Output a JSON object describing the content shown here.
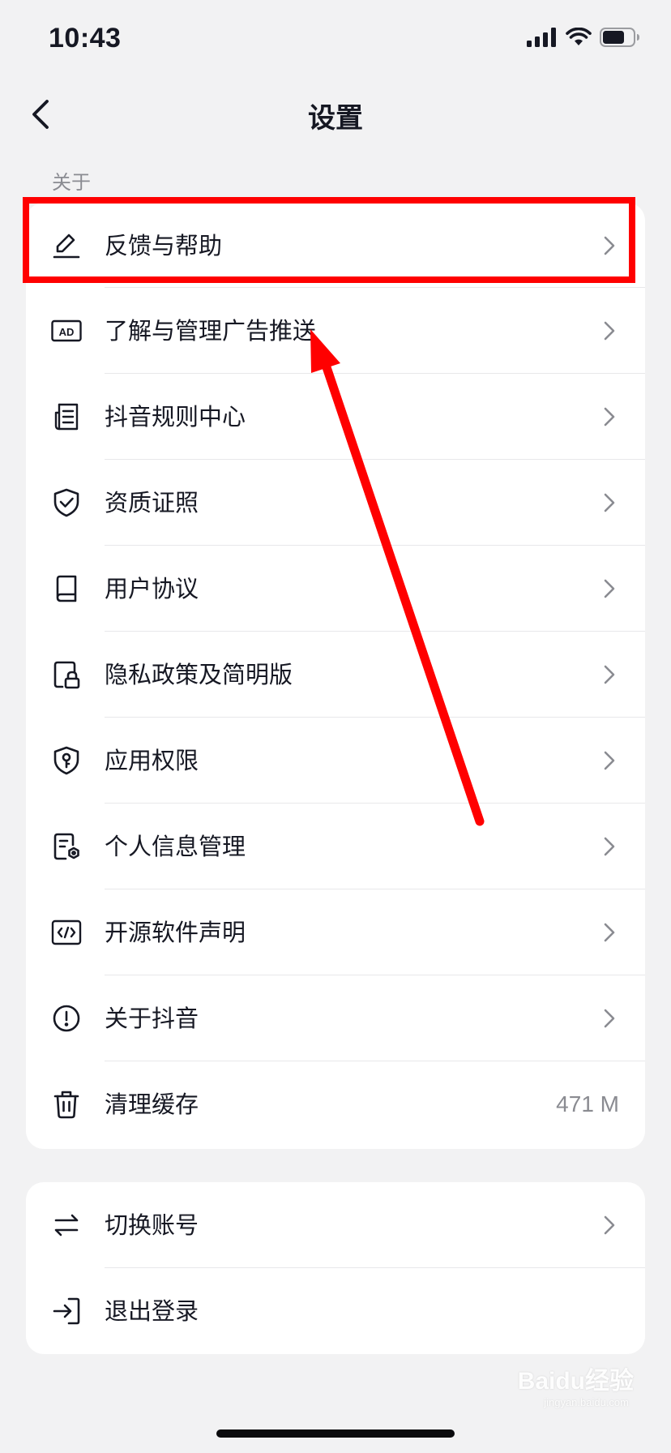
{
  "status_bar": {
    "time": "10:43",
    "icons": [
      "signal-icon",
      "wifi-icon",
      "battery-icon"
    ]
  },
  "nav": {
    "title": "设置",
    "back_icon": "chevron-left-icon"
  },
  "section_about": {
    "label": "关于",
    "items": [
      {
        "label": "反馈与帮助",
        "icon": "pencil-icon",
        "trailing": "chevron"
      },
      {
        "label": "了解与管理广告推送",
        "icon": "ad-icon",
        "trailing": "chevron"
      },
      {
        "label": "抖音规则中心",
        "icon": "document-list-icon",
        "trailing": "chevron"
      },
      {
        "label": "资质证照",
        "icon": "shield-check-icon",
        "trailing": "chevron"
      },
      {
        "label": "用户协议",
        "icon": "book-icon",
        "trailing": "chevron"
      },
      {
        "label": "隐私政策及简明版",
        "icon": "privacy-lock-icon",
        "trailing": "chevron"
      },
      {
        "label": "应用权限",
        "icon": "shield-key-icon",
        "trailing": "chevron"
      },
      {
        "label": "个人信息管理",
        "icon": "personal-info-icon",
        "trailing": "chevron"
      },
      {
        "label": "开源软件声明",
        "icon": "code-icon",
        "trailing": "chevron"
      },
      {
        "label": "关于抖音",
        "icon": "info-circle-icon",
        "trailing": "chevron"
      },
      {
        "label": "清理缓存",
        "icon": "trash-icon",
        "trailing": "value",
        "value": "471 M"
      }
    ]
  },
  "section_account": {
    "items": [
      {
        "label": "切换账号",
        "icon": "switch-arrows-icon",
        "trailing": "chevron"
      },
      {
        "label": "退出登录",
        "icon": "logout-icon",
        "trailing": "none"
      }
    ]
  },
  "annotation": {
    "highlight_color": "#ff0000"
  },
  "watermark": {
    "text": "Baidu经验",
    "sub": "jingyan.baidu.com"
  },
  "colors": {
    "background": "#f2f2f3",
    "card": "#ffffff",
    "text": "#161823",
    "secondary_text": "#8a8b91"
  }
}
